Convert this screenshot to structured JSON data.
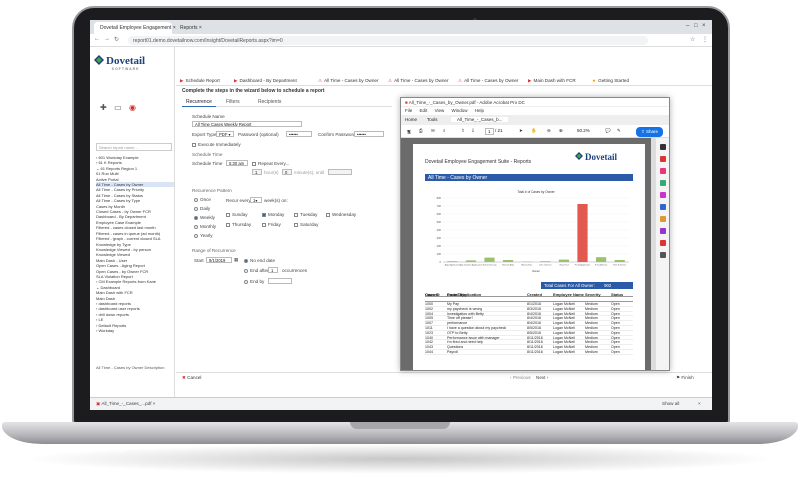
{
  "browser": {
    "tabs": [
      {
        "label": "Dovetail Employee Engagement"
      },
      {
        "label": "Reports"
      }
    ],
    "url": "report01.demo.dovetailnow.com/Insight/DovetailReports.aspx?im=0"
  },
  "app": {
    "logo_text": "Dovetail",
    "logo_sub": "SOFTWARE",
    "search_placeholder": "Search report name...",
    "tree": [
      "› 601 Workday Example",
      "› 61 K Reports",
      "⌄ 61 Reports Region 1",
      "  01 Run Multi",
      "  Active Portal",
      "  All Time - Cases by Owner",
      "  All Time - Cases by Priority",
      "  All Time - Cases by Status",
      "  All Time - Cases by Type",
      "  Cases by Month",
      "  Closed Cases - by Owner FCR",
      "  Dashboard - By Department",
      "  Employee Case Example",
      "  Filtered - cases closed last month",
      "  Filtered - cases in queue (ad month)",
      "  Filtered - graph - current closed SLA",
      "  Knowledge by Type",
      "  Knowledge Viewed - by person",
      "  Knowledge Viewed",
      "  Main Dash - User",
      "  Open Cases - Aging Report",
      "  Open Cases - by Owner FCR",
      "  SLA Violation Report",
      "› CM Example Reports from Kane",
      "⌄ Dashboard",
      "  Main Dash with FCR",
      "  Main Dash",
      "› dashboard reports",
      "› dashboard user reports",
      "› drill down reports",
      "› LE",
      "› Default Reports",
      "› Workday"
    ],
    "selected_index": 5,
    "description": "All Time - Cases by Owner Description",
    "topnav": [
      "Schedule Report",
      "Dashboard - By Department",
      "All Time - Cases by Owner",
      "All Time - Cases by Owner",
      "All Time - Cases by Owner",
      "Main Dash with FCR",
      "Getting Started"
    ]
  },
  "wizard": {
    "title": "Complete the steps in the wizard below to schedule a report",
    "tabs": [
      "Recurrence",
      "Filters",
      "Recipients"
    ],
    "schedule_name_label": "Schedule Name",
    "schedule_name_value": "All Time Cases Weekly Report",
    "export_type_label": "Export Type",
    "export_type_value": "PDF",
    "password_label": "Password (optional)",
    "password_value": "••••••",
    "confirm_label": "Confirm Password",
    "confirm_value": "••••••",
    "execute_immediately": "Execute Immediately",
    "schedule_time_header": "Schedule Time",
    "schedule_time_label": "Schedule Time",
    "schedule_time_value": "5:30 am",
    "repeat_every": "Repeat Every...",
    "hours_label": "hour(s)",
    "minutes_label": "minute(s), until",
    "recurrence_header": "Recurrence Pattern",
    "patterns": [
      "Once",
      "Daily",
      "Weekly",
      "Monthly",
      "Yearly"
    ],
    "recur_every": "Recur every",
    "recur_value": "1",
    "weeks_on": "week(s) on:",
    "days": [
      "Sunday",
      "Monday",
      "Tuesday",
      "Wednesday",
      "Thursday",
      "Friday",
      "Saturday"
    ],
    "range_header": "Range of Recurrence",
    "start_label": "Start",
    "start_value": "9/1/2019",
    "no_end": "No end date",
    "end_after": "End after",
    "end_after_value": "1",
    "occurrences": "occurrences",
    "end_by": "End by",
    "cancel": "Cancel",
    "previous": "Previous",
    "next": "Next",
    "finish": "Finish"
  },
  "pdf": {
    "window_title": "All_Time_-_Cases_by_Owner.pdf - Adobe Acrobat Pro DC",
    "menu": [
      "File",
      "Edit",
      "View",
      "Window",
      "Help"
    ],
    "tabs": [
      "Home",
      "Tools",
      "All_Time_-_Cases_b..."
    ],
    "page_num": "1",
    "page_total": "/ 21",
    "zoom": "50.2%",
    "share": "Share",
    "report_header": "Dovetail Employee Engagement Suite - Reports",
    "report_logo": "Dovetail",
    "banner": "All Time - Cases by Owner",
    "total_label": "Total Cases For All Owner:",
    "total_value": "902",
    "owner_label": "Owner:",
    "owner_value": "Portal Application",
    "columns": [
      "Case ID",
      "Case Title",
      "Created",
      "Employee Name",
      "Severity",
      "Status"
    ],
    "rows": [
      [
        "1000",
        "My Pay",
        "8/1/2016",
        "Logan McNeil",
        "Medium",
        "Open"
      ],
      [
        "1002",
        "my paycheck is wrong",
        "8/3/2016",
        "Logan McNeil",
        "Medium",
        "Open"
      ],
      [
        "1004",
        "Investigation with Betty",
        "8/4/2016",
        "Logan McNeil",
        "Medium",
        "Open"
      ],
      [
        "1005",
        "Time off please?",
        "8/4/2016",
        "Logan McNeil",
        "Medium",
        "Open"
      ],
      [
        "1007",
        "performance",
        "8/4/2016",
        "Logan McNeil",
        "Medium",
        "Open"
      ],
      [
        "1011",
        "I have a question about my paycheck",
        "8/5/2016",
        "Logan McNeil",
        "Medium",
        "Open"
      ],
      [
        "1023",
        "OTP to Betty",
        "8/5/2016",
        "Logan McNeil",
        "Medium",
        "Open"
      ],
      [
        "1040",
        "Performance issue with manager",
        "8/11/2016",
        "Logan McNeil",
        "Medium",
        "Open"
      ],
      [
        "1042",
        "I'm fired and need help",
        "8/11/2016",
        "Logan McNeil",
        "Medium",
        "Open"
      ],
      [
        "1043",
        "Questions",
        "8/11/2016",
        "Logan McNeil",
        "Medium",
        "Open"
      ],
      [
        "1044",
        "Payroll",
        "8/11/2016",
        "Logan McNeil",
        "Medium",
        "Open"
      ]
    ]
  },
  "download_bar": {
    "file": "All_Time_-_Cases_...pdf",
    "show_all": "Show all"
  },
  "chart_data": {
    "type": "bar",
    "title": "Total # of Cases by Owner",
    "xlabel": "Owner",
    "ylabel": "",
    "ylim": [
      0,
      800
    ],
    "yticks": [
      0,
      100,
      200,
      300,
      400,
      500,
      600,
      700,
      800
    ],
    "categories": [
      "Angie Application",
      "App Inquiries Application",
      "Active Directory",
      "Michael Ainly",
      "Bob Dalmon",
      "John Johnson",
      "Olivia Paul",
      "Portal Application",
      "Pam Andrews",
      "Patti Schiemer"
    ],
    "values": [
      10,
      20,
      55,
      25,
      5,
      10,
      30,
      725,
      60,
      25
    ],
    "colors": [
      "#9bc26b",
      "#9bc26b",
      "#9bc26b",
      "#9bc26b",
      "#9bc26b",
      "#9bc26b",
      "#9bc26b",
      "#e25a4f",
      "#9bc26b",
      "#9bc26b"
    ]
  }
}
